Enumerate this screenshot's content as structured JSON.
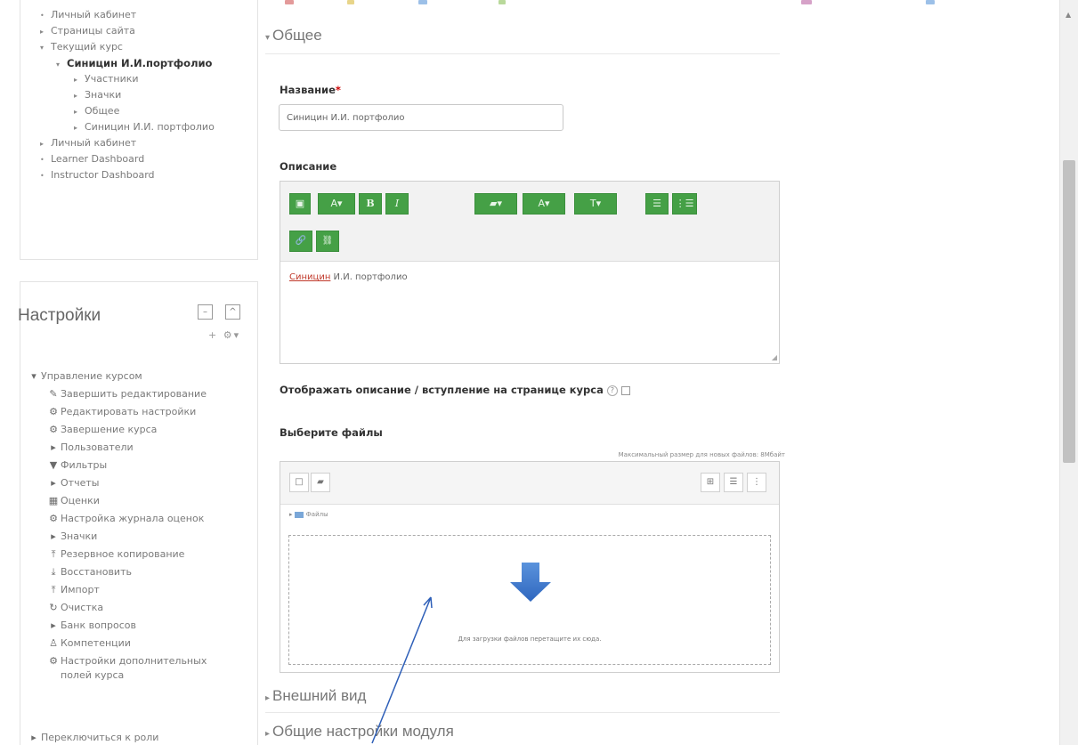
{
  "nav": {
    "items": [
      {
        "label": "Личный кабинет",
        "marker": "•"
      },
      {
        "label": "Страницы сайта",
        "marker": "▸"
      },
      {
        "label": "Текущий курс",
        "marker": "▾"
      },
      {
        "label": "Синицин И.И.портфолио",
        "marker": "▾"
      },
      {
        "label": "Участники",
        "marker": "▸"
      },
      {
        "label": "Значки",
        "marker": "▸"
      },
      {
        "label": "Общее",
        "marker": "▸"
      },
      {
        "label": "Синицин И.И. портфолио",
        "marker": "▸"
      },
      {
        "label": "Личный кабинет",
        "marker": "▸"
      },
      {
        "label": "Learner Dashboard",
        "marker": "•"
      },
      {
        "label": "Instructor Dashboard",
        "marker": "•"
      }
    ]
  },
  "settings": {
    "title": "Настройки",
    "add_icon": "plus-icon",
    "gear_icon": "gear-icon",
    "items": [
      {
        "label": "Управление курсом",
        "icon": "▾"
      },
      {
        "label": "Завершить редактирование",
        "icon": "✎"
      },
      {
        "label": "Редактировать настройки",
        "icon": "⚙"
      },
      {
        "label": "Завершение курса",
        "icon": "⚙"
      },
      {
        "label": "Пользователи",
        "icon": "▸"
      },
      {
        "label": "Фильтры",
        "icon": "▼"
      },
      {
        "label": "Отчеты",
        "icon": "▸"
      },
      {
        "label": "Оценки",
        "icon": "▦"
      },
      {
        "label": "Настройка журнала оценок",
        "icon": "⚙"
      },
      {
        "label": "Значки",
        "icon": "▸"
      },
      {
        "label": "Резервное копирование",
        "icon": "⤒"
      },
      {
        "label": "Восстановить",
        "icon": "⤓"
      },
      {
        "label": "Импорт",
        "icon": "⤒"
      },
      {
        "label": "Очистка",
        "icon": "↻"
      },
      {
        "label": "Банк вопросов",
        "icon": "▸"
      },
      {
        "label": "Компетенции",
        "icon": "♙"
      },
      {
        "label": "Настройки дополнительных",
        "icon": "⚙"
      },
      {
        "label": "полей курса",
        "icon": ""
      },
      {
        "label": "Переключиться к роли",
        "icon": "▸"
      }
    ]
  },
  "form": {
    "section_general": "Общее",
    "name_label": "Название",
    "required_mark": "*",
    "name_value": "Синицин И.И. портфолио",
    "description_label": "Описание",
    "editor_text_misspelled": "Синицин",
    "editor_text_rest": " И.И. портфолио",
    "show_description_label": "Отображать описание / вступление на странице курса",
    "files_label": "Выберите файлы",
    "max_size": "Максимальный размер для новых файлов: 8Мбайт",
    "files_folder": "Файлы",
    "drop_hint": "Для загрузки файлов перетащите их сюда.",
    "section_appearance": "Внешний вид",
    "section_module": "Общие настройки модуля"
  },
  "editor_toolbar": {
    "buttons": [
      {
        "name": "show-more-button",
        "glyph": "▣"
      },
      {
        "name": "font-style-button",
        "glyph": "A▾"
      },
      {
        "name": "bold-button",
        "glyph": "B"
      },
      {
        "name": "italic-button",
        "glyph": "I"
      },
      {
        "name": "highlight-button",
        "glyph": "▰▾"
      },
      {
        "name": "text-color-button",
        "glyph": "A▾"
      },
      {
        "name": "font-size-button",
        "glyph": "T▾"
      },
      {
        "name": "unordered-list-button",
        "glyph": "☰"
      },
      {
        "name": "ordered-list-button",
        "glyph": "⋮☰"
      },
      {
        "name": "link-button",
        "glyph": "🔗"
      },
      {
        "name": "unlink-button",
        "glyph": "⛓"
      }
    ]
  },
  "filemanager": {
    "add_file": "□",
    "create_folder": "▰",
    "view_icons": "⊞",
    "view_list": "☰",
    "view_tree": "⋮"
  },
  "colors": {
    "accent_green": "#45a046",
    "arrow_blue": "#2f6fc9",
    "required_red": "#cc0000"
  }
}
